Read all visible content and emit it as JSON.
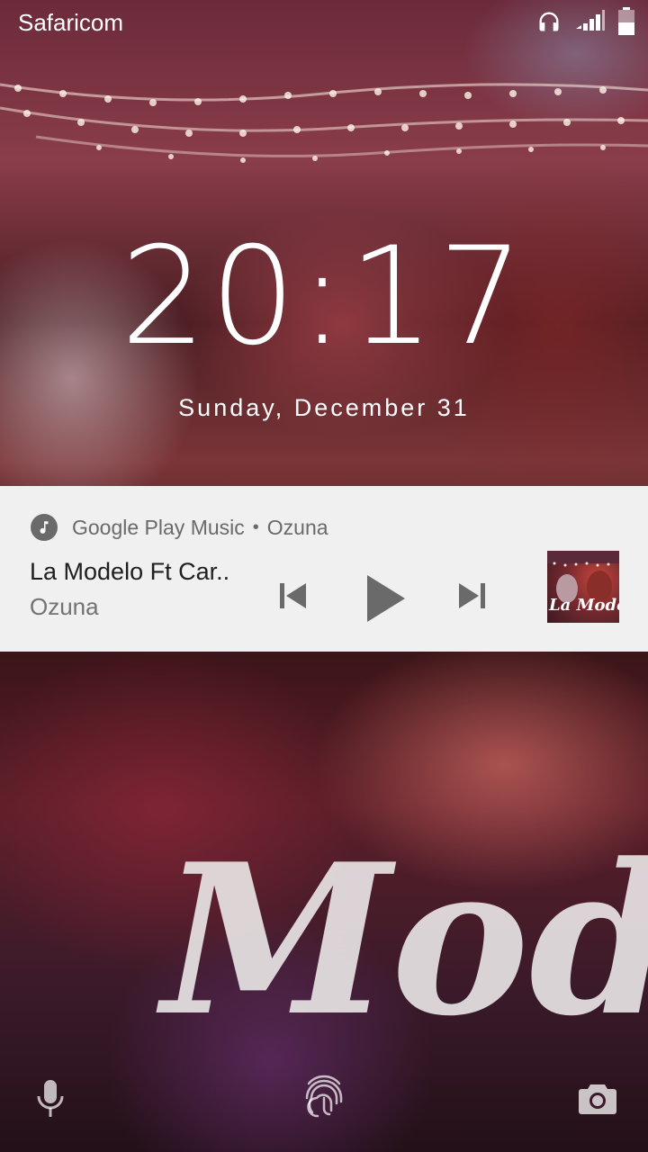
{
  "status_bar": {
    "carrier": "Safaricom",
    "icons": [
      "headphones-icon",
      "signal-icon",
      "battery-icon"
    ]
  },
  "lockscreen": {
    "time": "20:17",
    "date": "Sunday, December 31"
  },
  "media_notification": {
    "app_name": "Google Play Music",
    "separator": "•",
    "header_artist": "Ozuna",
    "track_title": "La Modelo Ft Car..",
    "track_artist": "Ozuna",
    "album_art_text": "La Modelo",
    "controls": [
      "previous-icon",
      "play-icon",
      "next-icon"
    ],
    "background": "#f1f0f0"
  },
  "wallpaper": {
    "overlay_word": "Mode"
  },
  "bottom_shortcuts": [
    "mic-icon",
    "fingerprint-icon",
    "camera-icon"
  ]
}
